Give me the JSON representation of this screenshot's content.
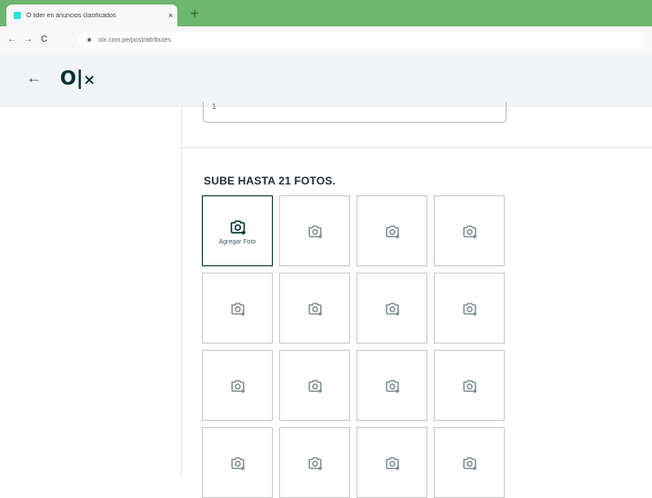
{
  "browser": {
    "tab_title": "O lider en anuncios clasificados",
    "tab_close": "×",
    "new_tab": "+",
    "url": "olx.com.pe/post/attributes",
    "back": "←",
    "forward": "→",
    "reload": "C"
  },
  "header": {
    "back_arrow": "←",
    "logo": "O|x"
  },
  "form": {
    "previous_input_value": "1",
    "photos_title": "SUBE HASTA 21 FOTOS.",
    "add_photo_label": "Agregar Foto",
    "slots_visible": 16
  },
  "colors": {
    "tab_bar": "#6cb66f",
    "brand": "#002f34",
    "accent_favicon": "#23e5db"
  }
}
